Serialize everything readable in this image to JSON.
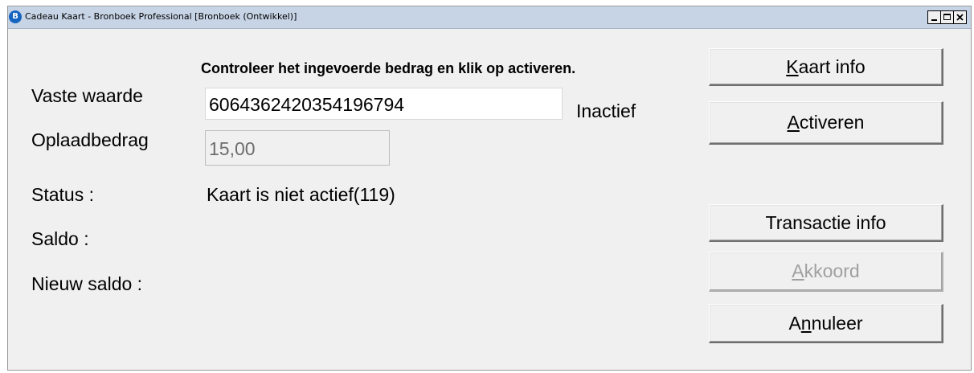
{
  "window": {
    "icon_letter": "B",
    "title": "Cadeau Kaart - Bronboek Professional [Bronboek (Ontwikkel)]"
  },
  "form": {
    "instruction": "Controleer het ingevoerde bedrag en klik op activeren.",
    "vaste_waarde_label": "Vaste waarde",
    "vaste_waarde_value": "6064362420354196794",
    "card_state": "Inactief",
    "oplaadbedrag_label": "Oplaadbedrag",
    "oplaadbedrag_value": "15,00",
    "status_label": "Status :",
    "status_value": "Kaart is niet actief(119)",
    "saldo_label": "Saldo :",
    "nieuw_saldo_label": "Nieuw saldo :"
  },
  "buttons": {
    "kaart_info": {
      "mnemonic": "K",
      "rest": "aart info"
    },
    "activeren": {
      "mnemonic": "A",
      "rest": "ctiveren"
    },
    "transactie_info": {
      "label": "Transactie info"
    },
    "akkoord": {
      "mnemonic": "A",
      "rest": "kkoord",
      "enabled": false
    },
    "annuleer": {
      "before": "A",
      "mnemonic": "n",
      "rest": "nuleer"
    }
  }
}
